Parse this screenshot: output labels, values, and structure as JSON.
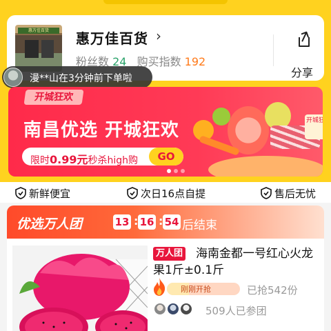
{
  "store": {
    "name": "惠万佳百货",
    "arrow": "›",
    "fans_label": "粉丝数",
    "fans_count": "24",
    "buy_index_label": "购买指数",
    "buy_index": "192",
    "share_label": "分享",
    "photo_sign": "惠万佳百货"
  },
  "toast": {
    "text": "漫**山在3分钟前下单啦"
  },
  "banner": {
    "tag": "开城狂欢",
    "title": "南昌优选 开城狂欢",
    "promo_prefix": "限时",
    "promo_price": "0.99元",
    "promo_suffix": "秒杀high购",
    "go_label": "GO",
    "box_text": "开城狂欢",
    "active_slide": 1,
    "slide_count": 3
  },
  "guarantees": [
    {
      "label": "新鲜便宜",
      "icon": "shield-check-icon"
    },
    {
      "label": "次日16点自提",
      "icon": "shield-check-icon"
    },
    {
      "label": "售后无忧",
      "icon": "shield-check-icon"
    }
  ],
  "flash_sale": {
    "title": "优选万人团",
    "timer": [
      "13",
      "16",
      "54"
    ],
    "timer_suffix": "后结束",
    "product": {
      "tag": "万人团",
      "title": "海南金都一号红心火龙果1斤±0.1斤",
      "progress_label": "刚刚开抢",
      "progress_fraction": 0.3,
      "sold": "已抢542份",
      "joined": "509人已参团"
    }
  },
  "colors": {
    "brand_yellow": "#ffd21f",
    "accent_red": "#e8163c",
    "fans_green": "#2aa26a",
    "index_orange": "#ff7a1a"
  }
}
